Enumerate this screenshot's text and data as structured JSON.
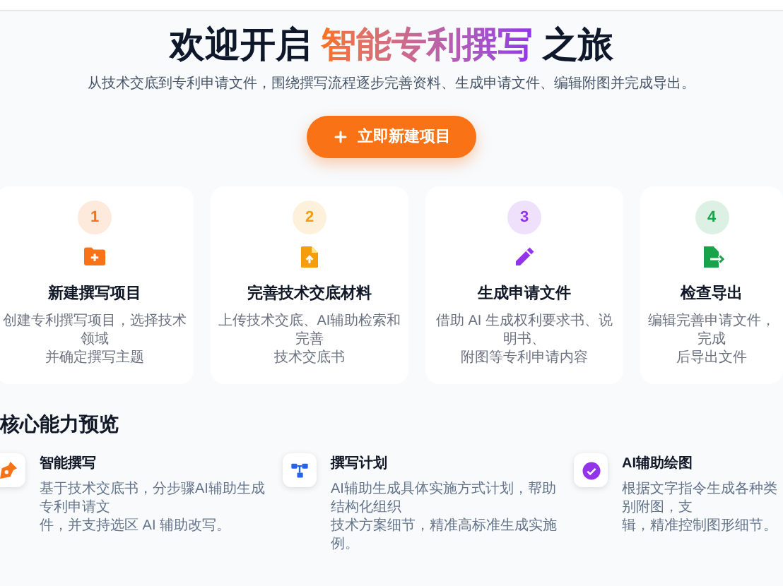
{
  "hero": {
    "title_start": "欢迎开启",
    "title_highlight": "智能专利撰写",
    "title_end": "之旅",
    "subtitle": "从技术交底到专利申请文件，围绕撰写流程逐步完善资料、生成申请文件、编辑附图并完成导出。",
    "button": "立即新建项目"
  },
  "steps": [
    {
      "number": "1",
      "color": "#f97316",
      "title": "新建撰写项目",
      "description_lines": [
        "创建专利撰写项目，选择技术领域",
        "并确定撰写主题"
      ]
    },
    {
      "number": "2",
      "color": "#f59e0b",
      "title": "完善技术交底材料",
      "description_lines": [
        "上传技术交底、AI辅助检索和完善",
        "技术交底书"
      ]
    },
    {
      "number": "3",
      "color": "#9333ea",
      "title": "生成申请文件",
      "description_lines": [
        "借助 AI 生成权利要求书、说明书、",
        "附图等专利申请内容"
      ]
    },
    {
      "number": "4",
      "color": "#16a34a",
      "title": "检查导出",
      "description_lines": [
        "编辑完善申请文件，完成",
        "后导出文件"
      ]
    }
  ],
  "features_section": {
    "heading": "核心能力预览",
    "features": [
      {
        "title": "智能撰写",
        "description_lines": [
          "基于技术交底书，分步骤AI辅助生成专利申请文",
          "件，并支持选区 AI 辅助改写。"
        ]
      },
      {
        "title": "撰写计划",
        "description_lines": [
          "AI辅助生成具体实施方式计划，帮助结构化组织",
          "技术方案细节，精准高标准生成实施例。"
        ]
      },
      {
        "title": "AI辅助绘图",
        "description_lines": [
          "根据文字指令生成各种类别附图，支",
          "辑，精准控制图形细节。"
        ]
      }
    ]
  }
}
